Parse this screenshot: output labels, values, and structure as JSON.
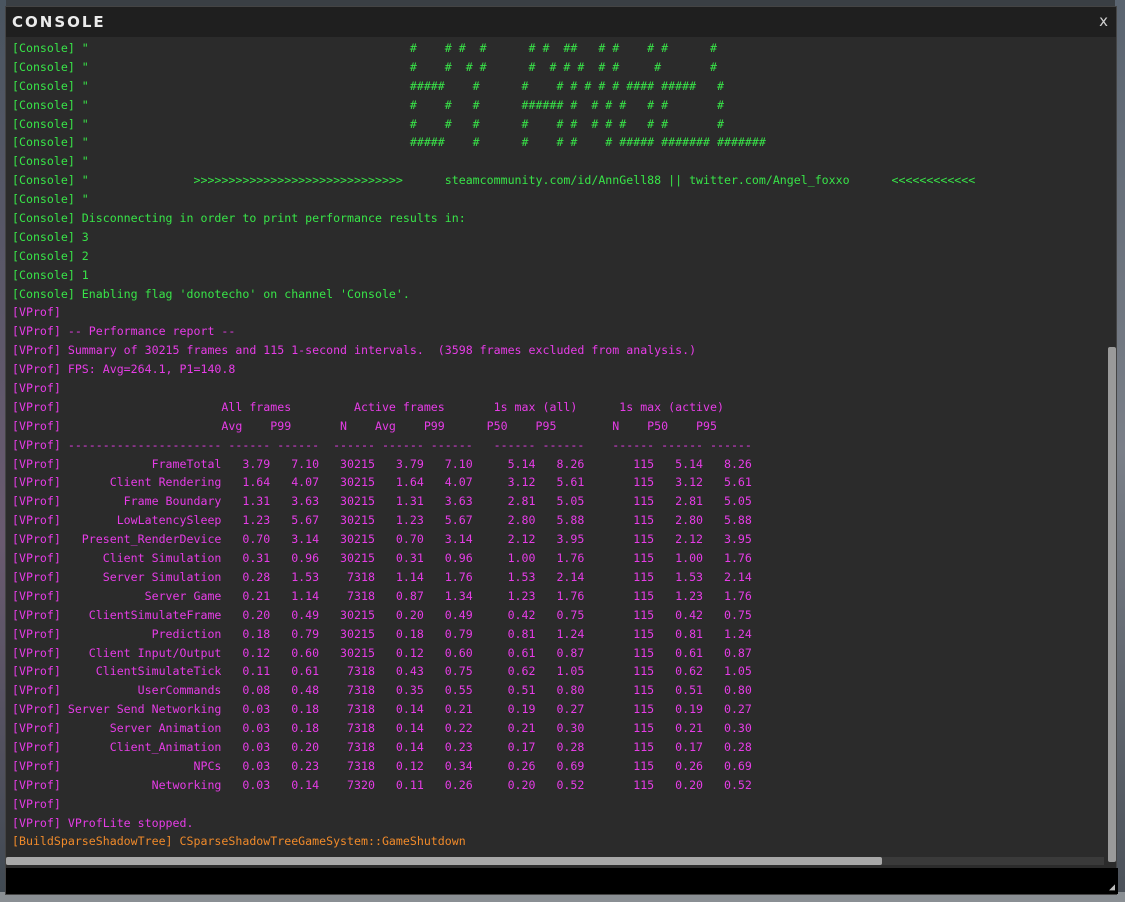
{
  "window": {
    "title": "CONSOLE",
    "close_label": "x"
  },
  "log_lines": [
    {
      "text": "[Console] \"                                              #    # #  #      # #  ##   # #    # #      #",
      "color": "green"
    },
    {
      "text": "[Console] \"                                              #    #  # #      #  # # #  # #     #       #",
      "color": "green"
    },
    {
      "text": "[Console] \"                                              #####    #      #    # # # # # #### #####   #",
      "color": "green"
    },
    {
      "text": "[Console] \"                                              #    #   #      ###### #  # # #   # #       #",
      "color": "green"
    },
    {
      "text": "[Console] \"                                              #    #   #      #    # #  # # #   # #       #",
      "color": "green"
    },
    {
      "text": "[Console] \"                                              #####    #      #    # #    # ##### ####### #######",
      "color": "green"
    },
    {
      "text": "[Console] \"",
      "color": "green"
    },
    {
      "text": "[Console] \"               >>>>>>>>>>>>>>>>>>>>>>>>>>>>>>      steamcommunity.com/id/AnnGell88 || twitter.com/Angel_foxxo      <<<<<<<<<<<<",
      "color": "green"
    },
    {
      "text": "[Console] \"",
      "color": "green"
    },
    {
      "text": "[Console] Disconnecting in order to print performance results in:",
      "color": "green"
    },
    {
      "text": "[Console] 3",
      "color": "green"
    },
    {
      "text": "[Console] 2",
      "color": "green"
    },
    {
      "text": "[Console] 1",
      "color": "green"
    },
    {
      "text": "[Console] Enabling flag 'donotecho' on channel 'Console'.",
      "color": "green"
    },
    {
      "text": "[VProf]",
      "color": "magenta"
    },
    {
      "text": "[VProf] -- Performance report --",
      "color": "magenta"
    },
    {
      "text": "[VProf] Summary of 30215 frames and 115 1-second intervals.  (3598 frames excluded from analysis.)",
      "color": "magenta"
    },
    {
      "text": "[VProf] FPS: Avg=264.1, P1=140.8",
      "color": "magenta"
    },
    {
      "text": "[VProf]",
      "color": "magenta"
    },
    {
      "text": "[VProf]                       All frames         Active frames       1s max (all)      1s max (active)",
      "color": "magenta"
    },
    {
      "text": "[VProf]                       Avg    P99       N    Avg    P99      P50    P95        N    P50    P95",
      "color": "magenta"
    },
    {
      "text": "[VProf] ---------------------- ------ ------  ------ ------ ------   ------ ------    ------ ------ ------",
      "color": "magenta"
    },
    {
      "text": "[VProf]             FrameTotal   3.79   7.10   30215   3.79   7.10     5.14   8.26       115   5.14   8.26",
      "color": "magenta"
    },
    {
      "text": "[VProf]       Client Rendering   1.64   4.07   30215   1.64   4.07     3.12   5.61       115   3.12   5.61",
      "color": "magenta"
    },
    {
      "text": "[VProf]         Frame Boundary   1.31   3.63   30215   1.31   3.63     2.81   5.05       115   2.81   5.05",
      "color": "magenta"
    },
    {
      "text": "[VProf]        LowLatencySleep   1.23   5.67   30215   1.23   5.67     2.80   5.88       115   2.80   5.88",
      "color": "magenta"
    },
    {
      "text": "[VProf]   Present_RenderDevice   0.70   3.14   30215   0.70   3.14     2.12   3.95       115   2.12   3.95",
      "color": "magenta"
    },
    {
      "text": "[VProf]      Client Simulation   0.31   0.96   30215   0.31   0.96     1.00   1.76       115   1.00   1.76",
      "color": "magenta"
    },
    {
      "text": "[VProf]      Server Simulation   0.28   1.53    7318   1.14   1.76     1.53   2.14       115   1.53   2.14",
      "color": "magenta"
    },
    {
      "text": "[VProf]            Server Game   0.21   1.14    7318   0.87   1.34     1.23   1.76       115   1.23   1.76",
      "color": "magenta"
    },
    {
      "text": "[VProf]    ClientSimulateFrame   0.20   0.49   30215   0.20   0.49     0.42   0.75       115   0.42   0.75",
      "color": "magenta"
    },
    {
      "text": "[VProf]             Prediction   0.18   0.79   30215   0.18   0.79     0.81   1.24       115   0.81   1.24",
      "color": "magenta"
    },
    {
      "text": "[VProf]    Client Input/Output   0.12   0.60   30215   0.12   0.60     0.61   0.87       115   0.61   0.87",
      "color": "magenta"
    },
    {
      "text": "[VProf]     ClientSimulateTick   0.11   0.61    7318   0.43   0.75     0.62   1.05       115   0.62   1.05",
      "color": "magenta"
    },
    {
      "text": "[VProf]           UserCommands   0.08   0.48    7318   0.35   0.55     0.51   0.80       115   0.51   0.80",
      "color": "magenta"
    },
    {
      "text": "[VProf] Server Send Networking   0.03   0.18    7318   0.14   0.21     0.19   0.27       115   0.19   0.27",
      "color": "magenta"
    },
    {
      "text": "[VProf]       Server Animation   0.03   0.18    7318   0.14   0.22     0.21   0.30       115   0.21   0.30",
      "color": "magenta"
    },
    {
      "text": "[VProf]       Client_Animation   0.03   0.20    7318   0.14   0.23     0.17   0.28       115   0.17   0.28",
      "color": "magenta"
    },
    {
      "text": "[VProf]                   NPCs   0.03   0.23    7318   0.12   0.34     0.26   0.69       115   0.26   0.69",
      "color": "magenta"
    },
    {
      "text": "[VProf]             Networking   0.03   0.14    7320   0.11   0.26     0.20   0.52       115   0.20   0.52",
      "color": "magenta"
    },
    {
      "text": "[VProf]",
      "color": "magenta"
    },
    {
      "text": "[VProf] VProfLite stopped.",
      "color": "magenta"
    },
    {
      "text": "[BuildSparseShadowTree] CSparseShadowTreeGameSystem::GameShutdown",
      "color": "orange"
    }
  ],
  "input": {
    "value": "",
    "placeholder": ""
  },
  "colors": {
    "green": "#38e448",
    "magenta": "#e63ce6",
    "orange": "#f08a2a"
  }
}
